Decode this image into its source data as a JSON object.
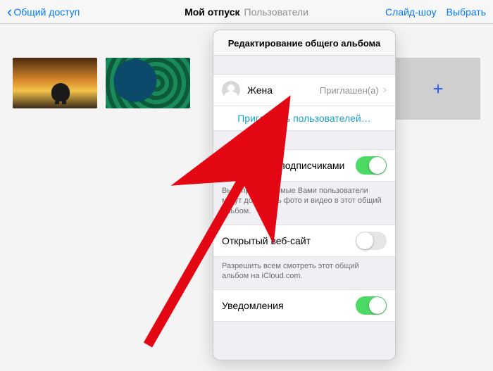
{
  "nav": {
    "back": "Общий доступ",
    "title": "Мой отпуск",
    "subtitle": "Пользователи",
    "slideshow": "Слайд-шоу",
    "select": "Выбрать"
  },
  "add_tile": {
    "symbol": "+"
  },
  "popover": {
    "header": "Редактирование общего альбома",
    "member": {
      "name": "Жена",
      "status": "Приглашен(а)"
    },
    "invite_label": "Пригласить пользователей…",
    "subscriber_posting": {
      "label": "Публикация подписчиками",
      "on": true,
      "note": "Вы и приглашаемые Вами пользователи могут добавлять фото и видео в этот общий альбом."
    },
    "public_site": {
      "label": "Открытый веб-сайт",
      "on": false,
      "note": "Разрешить всем смотреть этот общий альбом на iCloud.com."
    },
    "notifications": {
      "label": "Уведомления",
      "on": true
    }
  }
}
